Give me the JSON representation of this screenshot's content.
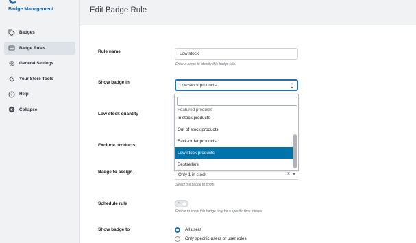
{
  "app": {
    "brand": "Badge Management"
  },
  "sidebar": {
    "items": [
      {
        "label": "Badges",
        "icon": "tag-icon",
        "active": false
      },
      {
        "label": "Badge Rules",
        "icon": "rules-icon",
        "active": true
      },
      {
        "label": "General Settings",
        "icon": "gear-icon",
        "active": false
      },
      {
        "label": "Your Store Tools",
        "icon": "tools-icon",
        "active": false
      },
      {
        "label": "Help",
        "icon": "help-icon",
        "active": false
      },
      {
        "label": "Collapse",
        "icon": "collapse-icon",
        "active": false
      }
    ]
  },
  "header": {
    "title": "Edit Badge Rule"
  },
  "form": {
    "rule_name": {
      "label": "Rule name",
      "value": "Low stock",
      "help": "Enter a name to identify this badge rule."
    },
    "show_badge_in": {
      "label": "Show badge in",
      "value": "Low stock products"
    },
    "low_stock_quantity": {
      "label": "Low stock quantity"
    },
    "exclude_products": {
      "label": "Exclude products"
    },
    "badge_to_assign": {
      "label": "Badge to assign",
      "value": "Only 1 in stock",
      "help": "Select the badge to show."
    },
    "schedule_rule": {
      "label": "Schedule rule",
      "help": "Enable to show this badge only for a specific time interval."
    },
    "show_badge_to": {
      "label": "Show badge to",
      "options": [
        "All users",
        "Only specific users or user roles"
      ],
      "selected": "All users"
    }
  },
  "dropdown": {
    "partial_option": "Featured products",
    "options": [
      "In stock products",
      "Out of stock products",
      "Back-order products",
      "Low stock products",
      "Bestsellers"
    ],
    "selected": "Low stock products"
  },
  "colors": {
    "accent": "#2271b1",
    "selected_option": "#0073aa",
    "brand": "#1f5f94"
  }
}
